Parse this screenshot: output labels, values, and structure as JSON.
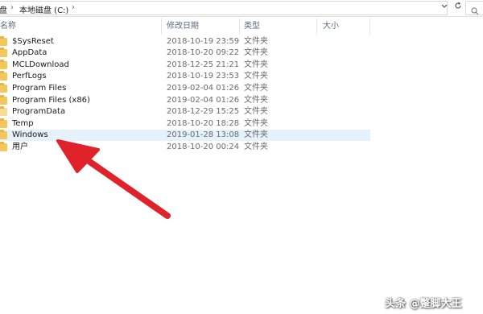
{
  "address_bar": {
    "crumbs": [
      "盘",
      "本地磁盘 (C:)"
    ],
    "dropdown_icon": "chevron-down-icon",
    "refresh_icon": "refresh-icon",
    "search_icon": "search-icon"
  },
  "columns": {
    "name": "名称",
    "date": "修改日期",
    "type": "类型",
    "size": "大小"
  },
  "rows": [
    {
      "name": "$SysReset",
      "date": "2018-10-19 23:59",
      "type": "文件夹"
    },
    {
      "name": "AppData",
      "date": "2018-10-20 09:22",
      "type": "文件夹"
    },
    {
      "name": "MCLDownload",
      "date": "2018-12-25 21:21",
      "type": "文件夹"
    },
    {
      "name": "PerfLogs",
      "date": "2018-10-19 23:53",
      "type": "文件夹"
    },
    {
      "name": "Program Files",
      "date": "2019-02-04 01:26",
      "type": "文件夹"
    },
    {
      "name": "Program Files (x86)",
      "date": "2019-02-04 01:26",
      "type": "文件夹"
    },
    {
      "name": "ProgramData",
      "date": "2018-12-29 15:25",
      "type": "文件夹"
    },
    {
      "name": "Temp",
      "date": "2018-10-20 18:28",
      "type": "文件夹"
    },
    {
      "name": "Windows",
      "date": "2019-01-28 13:08",
      "type": "文件夹"
    },
    {
      "name": "用户",
      "date": "2018-10-20 00:24",
      "type": "文件夹"
    }
  ],
  "selected_row": "Windows",
  "annotation_color": "#e0232b",
  "folder_color": "#f3c75b",
  "watermark": "头条 @蹩脚大王"
}
